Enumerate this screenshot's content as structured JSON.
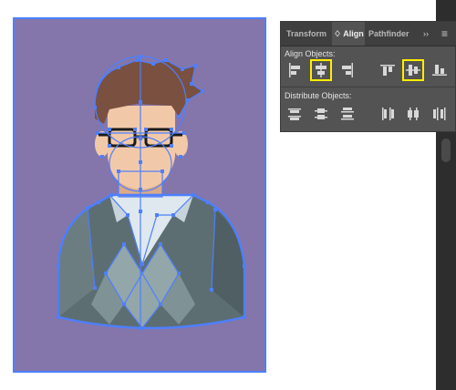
{
  "panel": {
    "tabs": [
      {
        "label": "Transform",
        "active": false
      },
      {
        "label": "♢ Align",
        "active": true
      },
      {
        "label": "Pathfinder",
        "active": false
      }
    ],
    "expand_label": "››",
    "menu_label": "≡",
    "align_objects_label": "Align Objects:",
    "distribute_objects_label": "Distribute Objects:"
  },
  "align_buttons": [
    {
      "icon": "horizontal-align-left-icon",
      "highlighted": false
    },
    {
      "icon": "horizontal-align-center-icon",
      "highlighted": true
    },
    {
      "icon": "horizontal-align-right-icon",
      "highlighted": false
    },
    {
      "icon": "vertical-align-top-icon",
      "highlighted": false
    },
    {
      "icon": "vertical-align-center-icon",
      "highlighted": true
    },
    {
      "icon": "vertical-align-bottom-icon",
      "highlighted": false
    }
  ],
  "distribute_buttons": [
    {
      "icon": "vertical-distribute-top-icon"
    },
    {
      "icon": "vertical-distribute-center-icon"
    },
    {
      "icon": "vertical-distribute-bottom-icon"
    },
    {
      "icon": "horizontal-distribute-left-icon"
    },
    {
      "icon": "horizontal-distribute-center-icon"
    },
    {
      "icon": "horizontal-distribute-right-icon"
    }
  ],
  "colors": {
    "artboard_bg": "#8476aa",
    "selection": "#4d7fff",
    "highlight": "#ffee00",
    "hair": "#7a5040",
    "skin": "#f2c9a8",
    "sweater": "#5d6e72",
    "diamond": "#93a6aa",
    "shirt": "#dfe8ee"
  }
}
